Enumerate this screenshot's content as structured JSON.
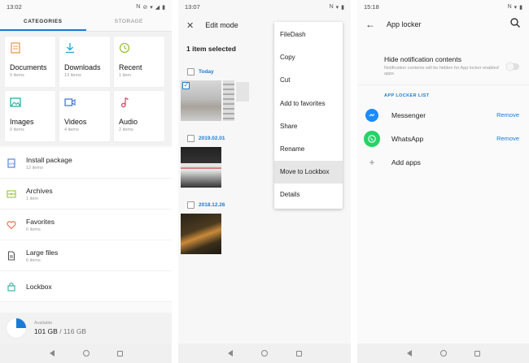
{
  "screen1": {
    "status_time": "13:02",
    "tabs": [
      "CATEGORIES",
      "STORAGE"
    ],
    "tiles": [
      {
        "label": "Documents",
        "count": "0 items",
        "icon": "document-icon",
        "color": "#e8a040"
      },
      {
        "label": "Downloads",
        "count": "13 items",
        "icon": "download-icon",
        "color": "#2aa0d8"
      },
      {
        "label": "Recent",
        "count": "1 item",
        "icon": "clock-icon",
        "color": "#9cc43a"
      },
      {
        "label": "Images",
        "count": "0 items",
        "icon": "image-icon",
        "color": "#2ab0a0"
      },
      {
        "label": "Videos",
        "count": "4 items",
        "icon": "video-icon",
        "color": "#4a7ad8"
      },
      {
        "label": "Audio",
        "count": "2 items",
        "icon": "music-icon",
        "color": "#d84a6a"
      }
    ],
    "list": [
      {
        "label": "Install package",
        "count": "12 items",
        "icon": "apk-icon",
        "color": "#4a7ad8"
      },
      {
        "label": "Archives",
        "count": "1 item",
        "icon": "archive-icon",
        "color": "#9cc43a"
      },
      {
        "label": "Favorites",
        "count": "0 items",
        "icon": "heart-icon",
        "color": "#e86a4a"
      },
      {
        "label": "Large files",
        "count": "6 items",
        "icon": "file-icon",
        "color": "#555555"
      },
      {
        "label": "Lockbox",
        "count": "",
        "icon": "lock-icon",
        "color": "#2ab0a0"
      }
    ],
    "storage": {
      "available_label": "Available",
      "used": "101 GB",
      "total": " / 116 GB",
      "used_fraction": 0.25
    }
  },
  "screen2": {
    "status_time": "13:07",
    "title": "Edit mode",
    "selected": "1 item selected",
    "dates": [
      "Today",
      "2019.02.01",
      "2018.12.26"
    ],
    "menu": [
      "FileDash",
      "Copy",
      "Cut",
      "Add to favorites",
      "Share",
      "Rename",
      "Move to Lockbox",
      "Details"
    ],
    "highlighted_menu_item": "Move to Lockbox"
  },
  "screen3": {
    "status_time": "15:18",
    "title": "App locker",
    "hide_title": "Hide notification contents",
    "hide_desc": "Notification contents will be hidden for App locker enabled apps",
    "section": "APP LOCKER LIST",
    "apps": [
      {
        "name": "Messenger",
        "action": "Remove",
        "color": "#1a8cff"
      },
      {
        "name": "WhatsApp",
        "action": "Remove",
        "color": "#25d366"
      }
    ],
    "add_label": "Add apps"
  },
  "colors": {
    "accent": "#1a7bd6"
  }
}
